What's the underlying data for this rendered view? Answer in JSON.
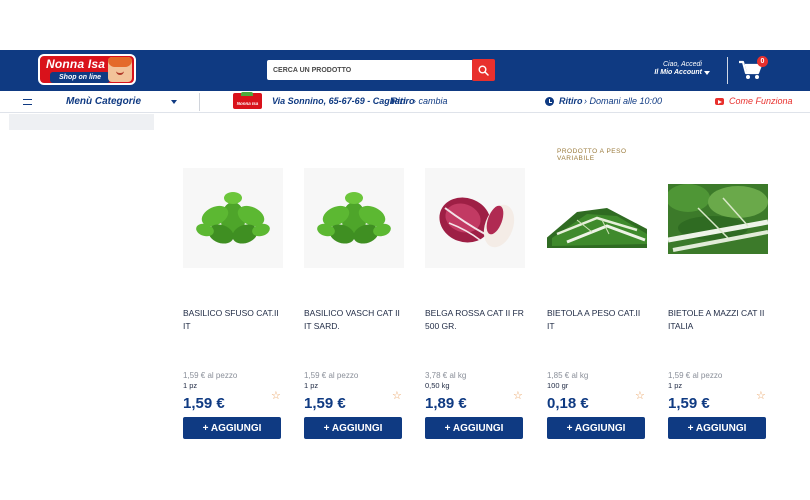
{
  "header": {
    "logo": {
      "brand": "Nonna Isa",
      "tagline": "Shop on line"
    },
    "search": {
      "placeholder": "CERCA UN PRODOTTO"
    },
    "account": {
      "greeting": "Ciao, Accedi",
      "label": "Il Mio Account"
    },
    "cart": {
      "count": "0"
    }
  },
  "subbar": {
    "menu_label": "Menù Categorie",
    "store_logo": "Nonna Isa",
    "address": "Via Sonnino, 65-67-69 - Cagliari",
    "ritiro_label": "Ritiro",
    "change_link": "› cambia",
    "pickup_label": "Ritiro",
    "pickup_when": "› Domani alle 10:00",
    "how_it_works": "Come Funziona"
  },
  "products": [
    {
      "badge": "",
      "name": "BASILICO SFUSO CAT.II IT",
      "unit_price": "1,59 € al pezzo",
      "qty": "1 pz",
      "price": "1,59 €",
      "button": "+ AGGIUNGI",
      "image": "basil"
    },
    {
      "badge": "",
      "name": "BASILICO VASCH CAT II IT SARD.",
      "unit_price": "1,59 € al pezzo",
      "qty": "1 pz",
      "price": "1,59 €",
      "button": "+ AGGIUNGI",
      "image": "basil"
    },
    {
      "badge": "",
      "name": "BELGA ROSSA CAT II FR 500 GR.",
      "unit_price": "3,78 € al kg",
      "qty": "0,50 kg",
      "price": "1,89 €",
      "button": "+ AGGIUNGI",
      "image": "radicchio"
    },
    {
      "badge": "PRODOTTO A PESO VARIABILE",
      "name": "BIETOLA A PESO CAT.II IT",
      "unit_price": "1,85 € al kg",
      "qty": "100 gr",
      "price": "0,18 €",
      "button": "+ AGGIUNGI",
      "image": "chard"
    },
    {
      "badge": "",
      "name": "BIETOLE A MAZZI CAT II ITALIA",
      "unit_price": "1,59 € al pezzo",
      "qty": "1 pz",
      "price": "1,59 €",
      "button": "+ AGGIUNGI",
      "image": "chard-bunch"
    }
  ],
  "colors": {
    "brand_blue": "#0f3a82",
    "accent_red": "#e8302d"
  }
}
